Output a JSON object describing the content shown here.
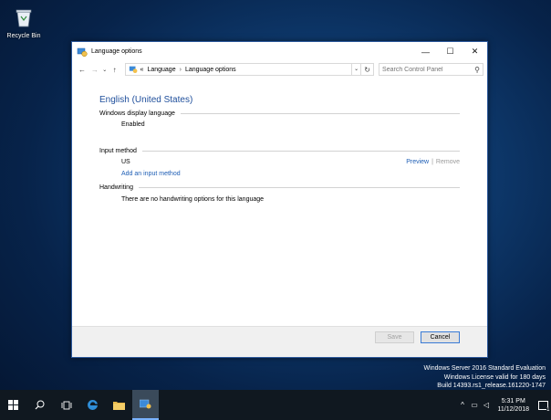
{
  "desktop": {
    "recycle_bin_label": "Recycle Bin",
    "watermark": {
      "line1": "Windows Server 2016 Standard Evaluation",
      "line2": "Windows License valid for 180 days",
      "line3": "Build 14393.rs1_release.161220-1747"
    }
  },
  "window": {
    "title": "Language options",
    "controls": {
      "minimize": "—",
      "maximize": "☐",
      "close": "✕"
    }
  },
  "navbar": {
    "breadcrumb": [
      "Language",
      "Language options"
    ],
    "overflow": "«",
    "search_placeholder": "Search Control Panel"
  },
  "content": {
    "language_name": "English (United States)",
    "display_language": {
      "header": "Windows display language",
      "status": "Enabled"
    },
    "input_method": {
      "header": "Input method",
      "methods": [
        {
          "name": "US",
          "preview": "Preview",
          "remove": "Remove"
        }
      ],
      "add_link": "Add an input method"
    },
    "handwriting": {
      "header": "Handwriting",
      "message": "There are no handwriting options for this language"
    }
  },
  "footer": {
    "save": "Save",
    "cancel": "Cancel"
  },
  "taskbar": {
    "clock_time": "5:31 PM",
    "clock_date": "11/12/2018",
    "notification_count": "1"
  },
  "colors": {
    "accent": "#1e4e9b",
    "link": "#1e5eb5",
    "taskbar": "#101820"
  }
}
